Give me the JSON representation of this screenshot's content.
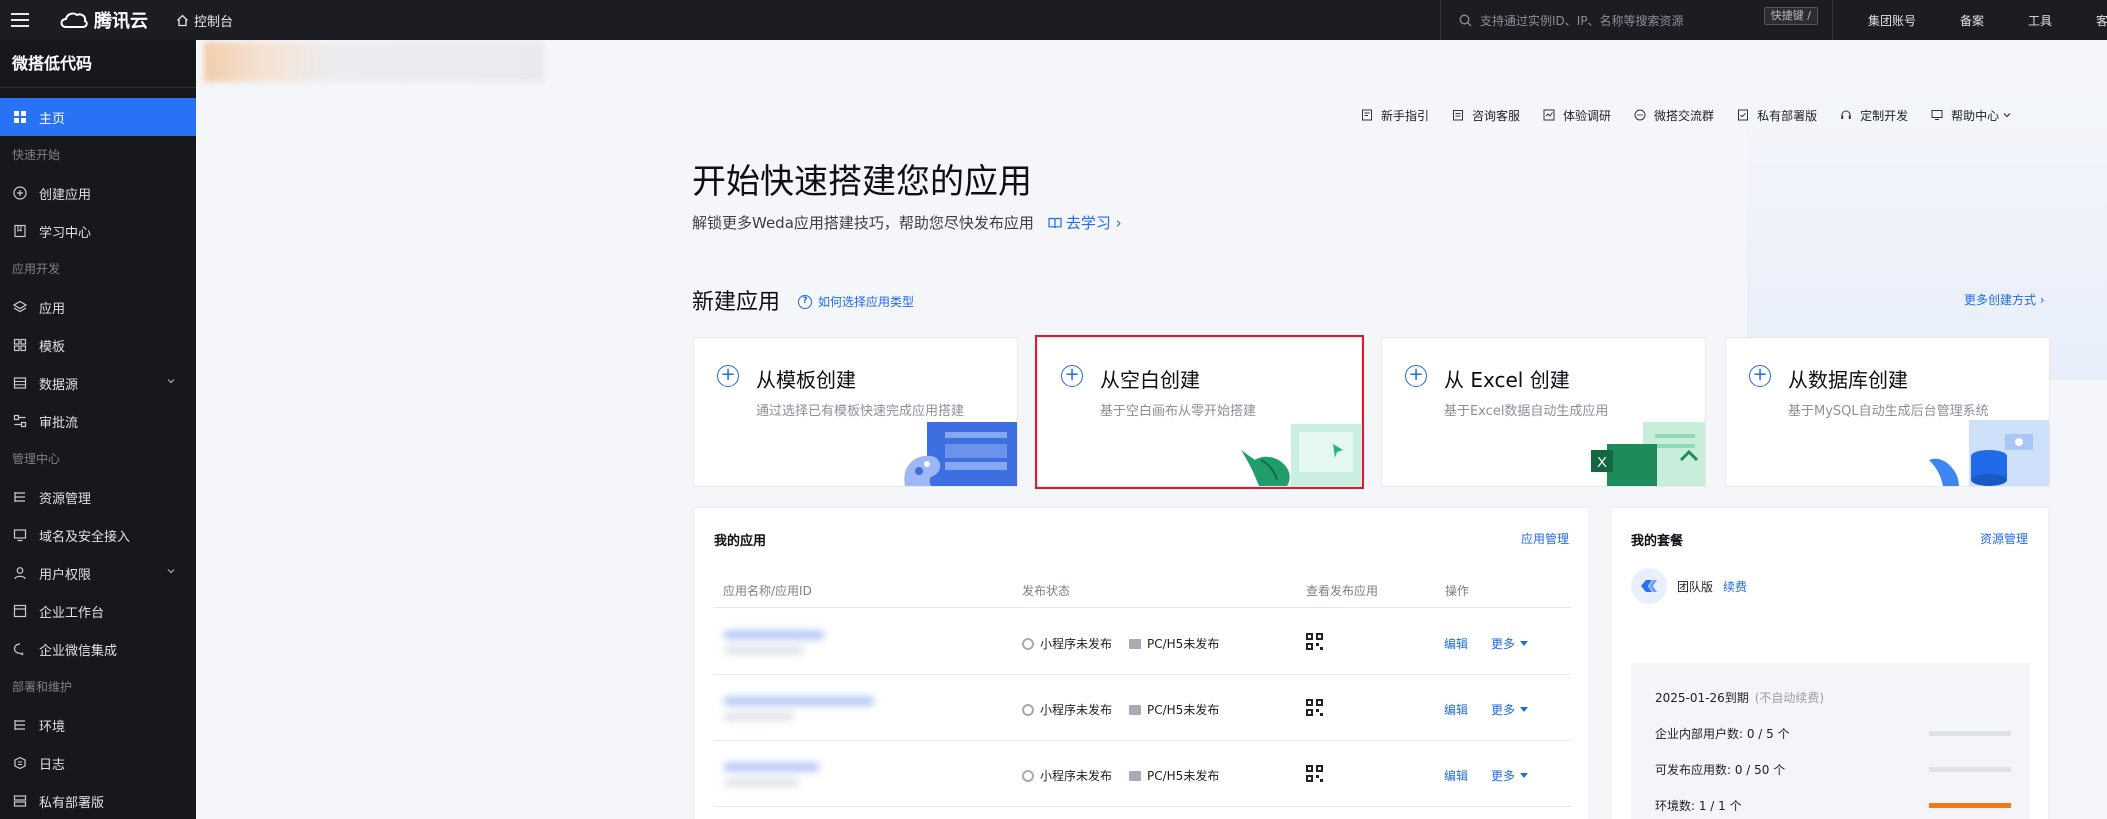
{
  "topbar": {
    "brand": "腾讯云",
    "console": "控制台",
    "search_placeholder": "支持通过实例ID、IP、名称等搜索资源",
    "search_shortcut": "快捷键 /",
    "links": [
      "集团账号",
      "备案",
      "工具",
      "客服支持"
    ]
  },
  "sidebar": {
    "app_title": "微搭低代码",
    "home": "主页",
    "sections": {
      "quick_start": "快速开始",
      "app_dev": "应用开发",
      "admin": "管理中心",
      "deploy": "部署和维护"
    },
    "items": {
      "create_app": "创建应用",
      "learning": "学习中心",
      "apps": "应用",
      "templates": "模板",
      "datasource": "数据源",
      "approval": "审批流",
      "resources": "资源管理",
      "domain": "域名及安全接入",
      "permissions": "用户权限",
      "enterprise_desk": "企业工作台",
      "wecom": "企业微信集成",
      "env": "环境",
      "logs": "日志",
      "private_deploy": "私有部署版"
    }
  },
  "help_links": [
    "新手指引",
    "咨询客服",
    "体验调研",
    "微搭交流群",
    "私有部署版",
    "定制开发",
    "帮助中心"
  ],
  "hero": {
    "title": "开始快速搭建您的应用",
    "subtitle": "解锁更多Weda应用搭建技巧，帮助您尽快发布应用",
    "learn": "去学习 ›"
  },
  "new_app": {
    "title": "新建应用",
    "help": "如何选择应用类型",
    "more": "更多创建方式 ›",
    "cards": [
      {
        "title": "从模板创建",
        "desc": "通过选择已有模板快速完成应用搭建"
      },
      {
        "title": "从空白创建",
        "desc": "基于空白画布从零开始搭建"
      },
      {
        "title": "从 Excel 创建",
        "desc": "基于Excel数据自动生成应用"
      },
      {
        "title": "从数据库创建",
        "desc": "基于MySQL自动生成后台管理系统"
      }
    ]
  },
  "my_apps": {
    "title": "我的应用",
    "manage": "应用管理",
    "columns": [
      "应用名称/应用ID",
      "发布状态",
      "查看发布应用",
      "操作"
    ],
    "rows": [
      {
        "mp_status": "小程序未发布",
        "web_status": "PC/H5未发布",
        "edit": "编辑",
        "more": "更多"
      },
      {
        "mp_status": "小程序未发布",
        "web_status": "PC/H5未发布",
        "edit": "编辑",
        "more": "更多"
      },
      {
        "mp_status": "小程序未发布",
        "web_status": "PC/H5未发布",
        "edit": "编辑",
        "more": "更多"
      }
    ]
  },
  "my_plan": {
    "title": "我的套餐",
    "manage": "资源管理",
    "plan_name": "团队版",
    "renew": "续费",
    "expiry": "2025-01-26到期",
    "auto_renew": "(不自动续费)",
    "stats": [
      {
        "label": "企业内部用户数: 0 / 5 个",
        "used": 0,
        "total": 5
      },
      {
        "label": "可发布应用数: 0 / 50 个",
        "used": 0,
        "total": 50
      },
      {
        "label": "环境数: 1 / 1 个",
        "used": 1,
        "total": 1
      }
    ]
  },
  "colors": {
    "accent": "#2a72f5",
    "link": "#1f6bea",
    "selected_outline": "#e3182d",
    "usage_bar": "#f47b14"
  }
}
